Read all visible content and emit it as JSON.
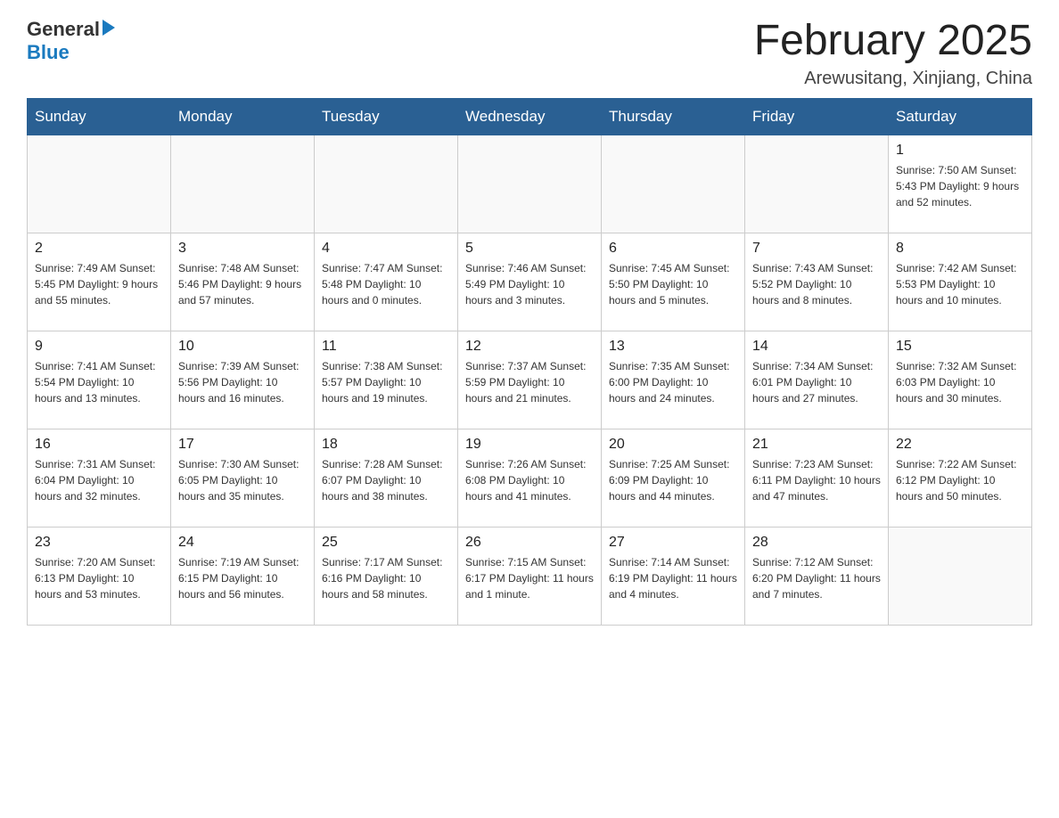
{
  "header": {
    "logo_general": "General",
    "logo_blue": "Blue",
    "title": "February 2025",
    "location": "Arewusitang, Xinjiang, China"
  },
  "weekdays": [
    "Sunday",
    "Monday",
    "Tuesday",
    "Wednesday",
    "Thursday",
    "Friday",
    "Saturday"
  ],
  "weeks": [
    [
      {
        "day": "",
        "info": ""
      },
      {
        "day": "",
        "info": ""
      },
      {
        "day": "",
        "info": ""
      },
      {
        "day": "",
        "info": ""
      },
      {
        "day": "",
        "info": ""
      },
      {
        "day": "",
        "info": ""
      },
      {
        "day": "1",
        "info": "Sunrise: 7:50 AM\nSunset: 5:43 PM\nDaylight: 9 hours\nand 52 minutes."
      }
    ],
    [
      {
        "day": "2",
        "info": "Sunrise: 7:49 AM\nSunset: 5:45 PM\nDaylight: 9 hours\nand 55 minutes."
      },
      {
        "day": "3",
        "info": "Sunrise: 7:48 AM\nSunset: 5:46 PM\nDaylight: 9 hours\nand 57 minutes."
      },
      {
        "day": "4",
        "info": "Sunrise: 7:47 AM\nSunset: 5:48 PM\nDaylight: 10 hours\nand 0 minutes."
      },
      {
        "day": "5",
        "info": "Sunrise: 7:46 AM\nSunset: 5:49 PM\nDaylight: 10 hours\nand 3 minutes."
      },
      {
        "day": "6",
        "info": "Sunrise: 7:45 AM\nSunset: 5:50 PM\nDaylight: 10 hours\nand 5 minutes."
      },
      {
        "day": "7",
        "info": "Sunrise: 7:43 AM\nSunset: 5:52 PM\nDaylight: 10 hours\nand 8 minutes."
      },
      {
        "day": "8",
        "info": "Sunrise: 7:42 AM\nSunset: 5:53 PM\nDaylight: 10 hours\nand 10 minutes."
      }
    ],
    [
      {
        "day": "9",
        "info": "Sunrise: 7:41 AM\nSunset: 5:54 PM\nDaylight: 10 hours\nand 13 minutes."
      },
      {
        "day": "10",
        "info": "Sunrise: 7:39 AM\nSunset: 5:56 PM\nDaylight: 10 hours\nand 16 minutes."
      },
      {
        "day": "11",
        "info": "Sunrise: 7:38 AM\nSunset: 5:57 PM\nDaylight: 10 hours\nand 19 minutes."
      },
      {
        "day": "12",
        "info": "Sunrise: 7:37 AM\nSunset: 5:59 PM\nDaylight: 10 hours\nand 21 minutes."
      },
      {
        "day": "13",
        "info": "Sunrise: 7:35 AM\nSunset: 6:00 PM\nDaylight: 10 hours\nand 24 minutes."
      },
      {
        "day": "14",
        "info": "Sunrise: 7:34 AM\nSunset: 6:01 PM\nDaylight: 10 hours\nand 27 minutes."
      },
      {
        "day": "15",
        "info": "Sunrise: 7:32 AM\nSunset: 6:03 PM\nDaylight: 10 hours\nand 30 minutes."
      }
    ],
    [
      {
        "day": "16",
        "info": "Sunrise: 7:31 AM\nSunset: 6:04 PM\nDaylight: 10 hours\nand 32 minutes."
      },
      {
        "day": "17",
        "info": "Sunrise: 7:30 AM\nSunset: 6:05 PM\nDaylight: 10 hours\nand 35 minutes."
      },
      {
        "day": "18",
        "info": "Sunrise: 7:28 AM\nSunset: 6:07 PM\nDaylight: 10 hours\nand 38 minutes."
      },
      {
        "day": "19",
        "info": "Sunrise: 7:26 AM\nSunset: 6:08 PM\nDaylight: 10 hours\nand 41 minutes."
      },
      {
        "day": "20",
        "info": "Sunrise: 7:25 AM\nSunset: 6:09 PM\nDaylight: 10 hours\nand 44 minutes."
      },
      {
        "day": "21",
        "info": "Sunrise: 7:23 AM\nSunset: 6:11 PM\nDaylight: 10 hours\nand 47 minutes."
      },
      {
        "day": "22",
        "info": "Sunrise: 7:22 AM\nSunset: 6:12 PM\nDaylight: 10 hours\nand 50 minutes."
      }
    ],
    [
      {
        "day": "23",
        "info": "Sunrise: 7:20 AM\nSunset: 6:13 PM\nDaylight: 10 hours\nand 53 minutes."
      },
      {
        "day": "24",
        "info": "Sunrise: 7:19 AM\nSunset: 6:15 PM\nDaylight: 10 hours\nand 56 minutes."
      },
      {
        "day": "25",
        "info": "Sunrise: 7:17 AM\nSunset: 6:16 PM\nDaylight: 10 hours\nand 58 minutes."
      },
      {
        "day": "26",
        "info": "Sunrise: 7:15 AM\nSunset: 6:17 PM\nDaylight: 11 hours\nand 1 minute."
      },
      {
        "day": "27",
        "info": "Sunrise: 7:14 AM\nSunset: 6:19 PM\nDaylight: 11 hours\nand 4 minutes."
      },
      {
        "day": "28",
        "info": "Sunrise: 7:12 AM\nSunset: 6:20 PM\nDaylight: 11 hours\nand 7 minutes."
      },
      {
        "day": "",
        "info": ""
      }
    ]
  ]
}
